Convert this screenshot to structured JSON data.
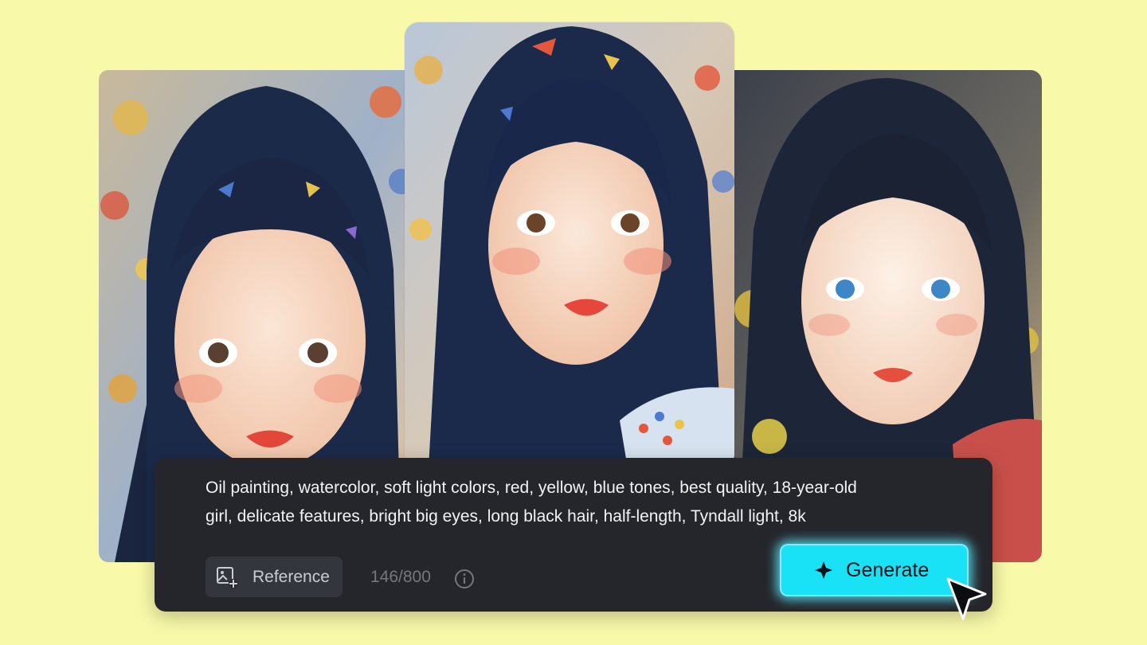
{
  "prompt": {
    "line1": "Oil painting, watercolor, soft light colors, red, yellow, blue tones, best quality, 18-year-old",
    "line2": "girl, delicate features, bright big eyes, long black hair, half-length, Tyndall light, 8k"
  },
  "reference_button": {
    "label": "Reference",
    "icon": "image-add-icon"
  },
  "char_counter": "146/800",
  "info": {
    "icon": "info-icon"
  },
  "generate_button": {
    "label": "Generate",
    "icon": "sparkle-icon"
  },
  "pointer": {
    "icon": "mouse-cursor-icon"
  },
  "colors": {
    "background": "#f8f9a9",
    "panel": "#24262b",
    "generate_accent": "#19e2f7",
    "hair": "#1c2a4a",
    "skin": "#f6d8c4"
  }
}
